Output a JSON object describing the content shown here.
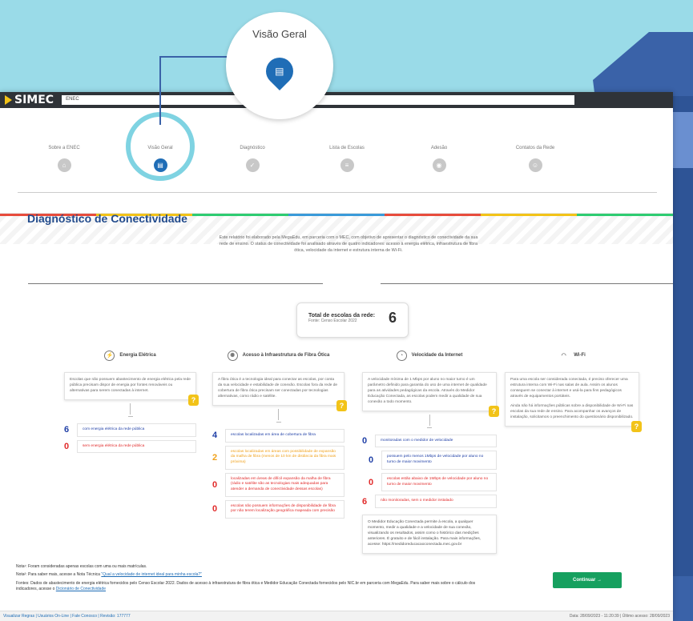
{
  "callout": {
    "label": "Visão Geral"
  },
  "header": {
    "logo": "SIMEC",
    "system": "ENEC"
  },
  "steps": [
    {
      "label": "Sobre a ENEC",
      "icon": "home-icon"
    },
    {
      "label": "Visão Geral",
      "icon": "document-icon"
    },
    {
      "label": "Diagnóstico",
      "icon": "check-icon"
    },
    {
      "label": "Lista de Escolas",
      "icon": "list-icon"
    },
    {
      "label": "Adesão",
      "icon": "eye-icon"
    },
    {
      "label": "Contatos da Rede",
      "icon": "people-icon"
    }
  ],
  "page": {
    "title": "Diagnóstico de Conectividade",
    "intro": "Este relatório foi elaborado pela MegaEdu, em parceria com o MEC, com objetivo de apresentar o diagnóstico de conectividade da sua rede de ensino. O status de conectividade foi analisado através de quatro indicadores: acesso à energia elétrica, infraestrutura de fibra ótica, velocidade da internet e estrutura interna de Wi-Fi."
  },
  "total": {
    "label": "Total de escolas da rede:",
    "source": "Fonte: Censo Escolar 2022",
    "value": "6"
  },
  "columns": {
    "energia": {
      "title": "Energia Elétrica",
      "desc": "Escolas que não possuem abastecimento de energia elétrica pela rede pública precisam dispor de energia por fontes renováveis ou alternativas para serem conectadas à internet.",
      "rows": [
        {
          "num": "6",
          "text": "com energia elétrica da rede pública"
        },
        {
          "num": "0",
          "text": "sem energia elétrica da rede pública"
        }
      ]
    },
    "fibra": {
      "title": "Acesso à Infraestrutura de Fibra Ótica",
      "desc": "A fibra ótica é a tecnologia ideal para conectar as escolas, por conta da sua velocidade e estabilidade de conexão. Escolas fora da rede de cobertura de fibra ótica precisam ser conectadas por tecnologias alternativas, como rádio e satélite.",
      "rows": [
        {
          "num": "4",
          "text": "escolas localizadas em área de cobertura de fibra"
        },
        {
          "num": "2",
          "text": "escolas localizadas em áreas com possibilidade de expansão da malha de fibra (menos de 10 km de distância da fibra mais próxima)"
        },
        {
          "num": "0",
          "text": "localizadas em áreas de difícil expansão da malha de fibra (rádio e satélite são as tecnologias mais adequadas para atender a demanda de conectividade dessas escolas)"
        },
        {
          "num": "0",
          "text": "escolas não possuem informações de disponibilidade de fibra por não terem localização geográfica mapeada com precisão"
        }
      ]
    },
    "velocidade": {
      "title": "Velocidade da Internet",
      "desc": "A velocidade mínima de 1 Mbps por aluno no maior turno é um parâmetro definido para garantia do uso de uma internet de qualidade para as atividades pedagógicas da escola. Através do Medidor Educação Conectada, as escolas podem medir a qualidade de sua conexão a todo momento.",
      "rows": [
        {
          "num": "0",
          "text": "monitoradas com o medidor de velocidade"
        },
        {
          "num": "0",
          "text": "possuem pelo menos 1Mbps de velocidade por aluno no turno de maior movimento"
        },
        {
          "num": "0",
          "text": "escolas estão abaixo de 1Mbps de velocidade por aluno no turno de maior movimento"
        },
        {
          "num": "6",
          "text": "não monitoradas, sem o medidor instalado"
        }
      ],
      "medidor": "O Medidor Educação Conectada permite à escola, a qualquer momento, medir a qualidade e a velocidade de sua conexão, visualizando os resultados, assim como o histórico das medições anteriores. É gratuito e de fácil instalação. Para mais informações, acesse: https://medidoreducacaoconectada.mec.gov.br"
    },
    "wifi": {
      "title": "Wi-Fi",
      "desc1": "Para uma escola ser considerada conectada, é preciso oferecer uma estrutura interna com Wi-Fi nas salas de aula. Assim os alunos conseguem se conectar à internet e usá-la para fins pedagógicos através de equipamentos portáteis.",
      "desc2": "Ainda não há informações públicas sobre a disponibilidade de Wi-Fi nas escolas da sua rede de ensino. Para acompanhar os avanços de instalação, solicitamos o preenchimento do questionário disponibilizado."
    }
  },
  "notes": {
    "n1": "Nota¹: Foram consideradas apenas escolas com uma ou mais matrículas.",
    "n2": "Nota²: Para saber mais, acesse a Nota Técnica",
    "n2link": "\"Qual a velocidade de internet ideal para minha escola?\"",
    "fontes": "Fontes: Dados de abastecimento de energia elétrica fornecidos pelo Censo Escolar 2022. Dados de acesso à infraestrutura de fibra ótica e Medidor Educação Conectada fornecidos pelo NIC.br em parceria com MegaEdu. Para saber mais sobre o cálculo dos indicadores, acesse o",
    "fonteslink": "Dicionário de Conectividade"
  },
  "continue_label": "Continuar →",
  "footer": {
    "left": "Visualizar Regras | Usuários On-Line | Fale Conosco | Revisão: 177777",
    "right": "Data: 28/09/2023 - 11:20:39 | Último acesso: 28/09/2023"
  },
  "colors": {
    "accent": "#1f6db6",
    "green": "#16a05f",
    "help": "#f2c318"
  }
}
